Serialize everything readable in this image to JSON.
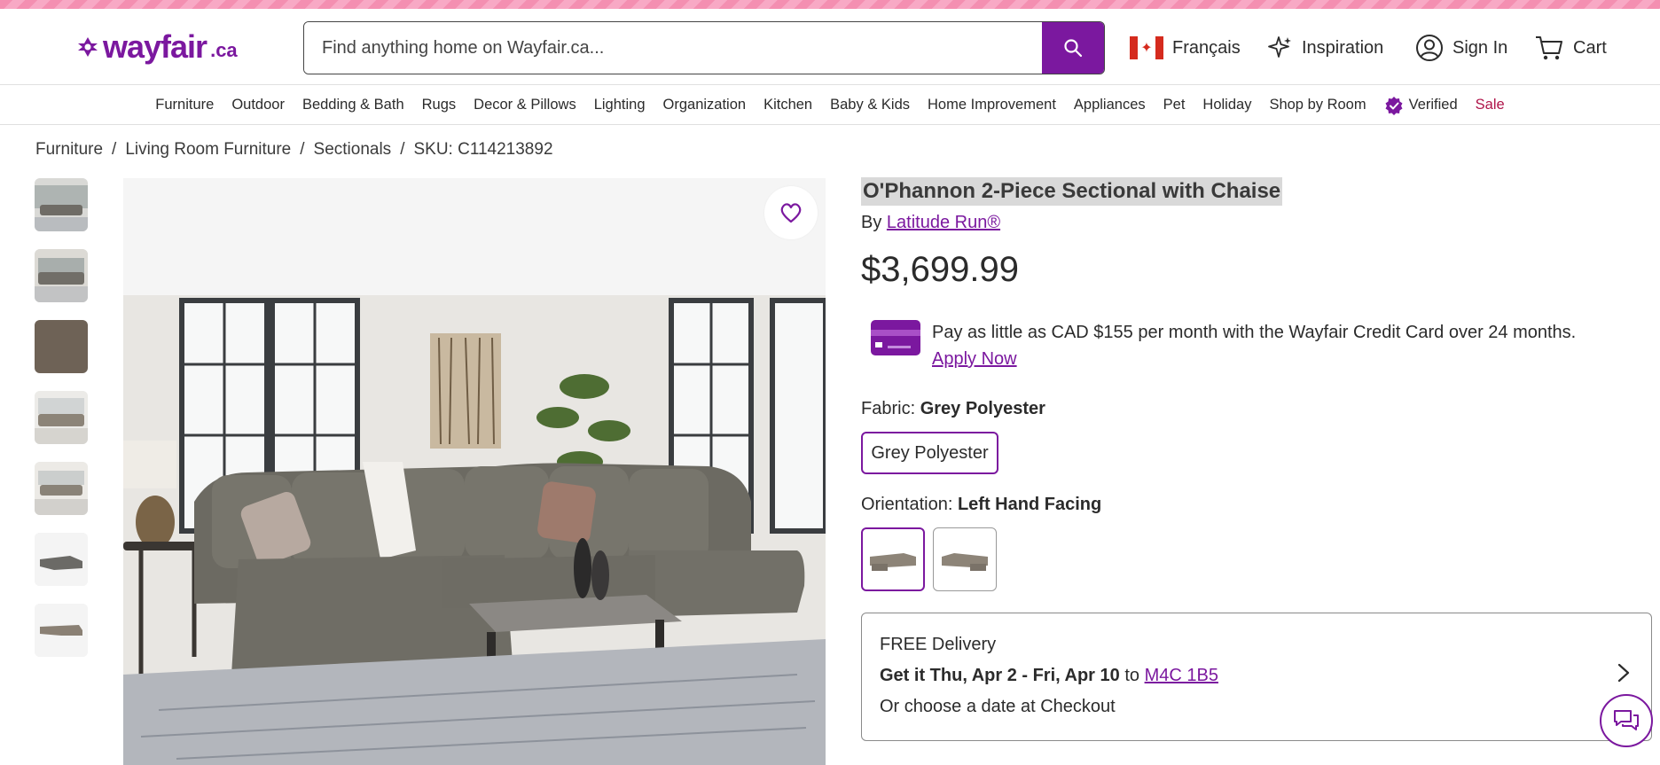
{
  "header": {
    "logo_word": "wayfair",
    "logo_tld": ".ca",
    "search_placeholder": "Find anything home on Wayfair.ca...",
    "language": "Français",
    "inspiration": "Inspiration",
    "sign_in": "Sign In",
    "cart": "Cart"
  },
  "categories": [
    "Furniture",
    "Outdoor",
    "Bedding & Bath",
    "Rugs",
    "Decor & Pillows",
    "Lighting",
    "Organization",
    "Kitchen",
    "Baby & Kids",
    "Home Improvement",
    "Appliances",
    "Pet",
    "Holiday",
    "Shop by Room",
    "Verified",
    "Sale"
  ],
  "breadcrumb": [
    "Furniture",
    "/",
    "Living Room Furniture",
    "/",
    "Sectionals",
    "/",
    "SKU: C114213892"
  ],
  "product": {
    "title": "O'Phannon 2-Piece Sectional with Chaise",
    "by_prefix": "By",
    "brand": "Latitude Run®",
    "price": "$3,699.99",
    "credit_text": "Pay as little as CAD $155 per month with the Wayfair Credit Card over 24 months.",
    "credit_link": "Apply Now",
    "fabric_label": "Fabric:",
    "fabric_value": "Grey Polyester",
    "fabric_option": "Grey Polyester",
    "orientation_label": "Orientation:",
    "orientation_value": "Left Hand Facing"
  },
  "delivery": {
    "line1": "FREE Delivery",
    "line2_bold": "Get it Thu, Apr 2 - Fri, Apr 10",
    "line2_to": "to",
    "postal": "M4C 1B5",
    "line3": "Or choose a date at Checkout"
  },
  "colors": {
    "brand": "#7b189f",
    "sale": "#b0154a",
    "stripe": "#f48fb1"
  }
}
